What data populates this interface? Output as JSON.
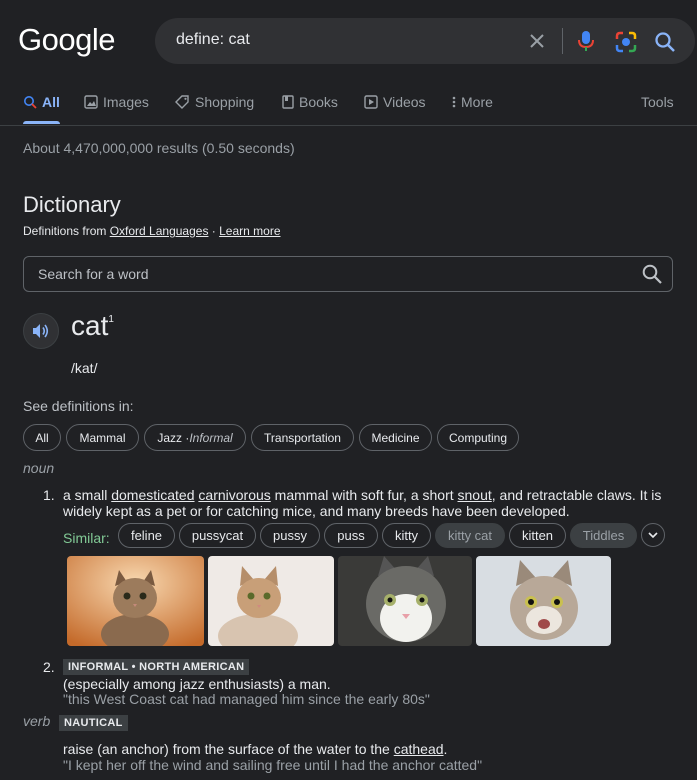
{
  "header": {
    "logo_text": "Google",
    "query": "define: cat",
    "icons": [
      "clear-icon",
      "microphone-icon",
      "lens-camera-icon",
      "search-icon"
    ]
  },
  "tabs": [
    {
      "label": "All",
      "icon": "search-icon",
      "active": true
    },
    {
      "label": "Images",
      "icon": "image-icon"
    },
    {
      "label": "Shopping",
      "icon": "tag-icon"
    },
    {
      "label": "Books",
      "icon": "book-icon"
    },
    {
      "label": "Videos",
      "icon": "play-icon"
    },
    {
      "label": "More",
      "icon": "more-vert-icon"
    }
  ],
  "tools_label": "Tools",
  "result_stats": "About 4,470,000,000 results (0.50 seconds)",
  "dictionary": {
    "title": "Dictionary",
    "source_prefix": "Definitions from ",
    "source_link": "Oxford Languages",
    "source_sep": " · ",
    "learn_more": "Learn more",
    "search_placeholder": "Search for a word",
    "word": "cat",
    "word_sup": "1",
    "pronunciation": "/kat/",
    "see_definitions_in": "See definitions in:",
    "domains": [
      "All",
      "Mammal",
      "Jazz · ",
      "Informal",
      "Transportation",
      "Medicine",
      "Computing"
    ],
    "noun_label": "noun",
    "verb_label": "verb",
    "def1_num": "1.",
    "def1_a": "a small ",
    "def1_l1": "domesticated",
    "def1_b": " ",
    "def1_l2": "carnivorous",
    "def1_c": " mammal with soft fur, a short ",
    "def1_l3": "snout",
    "def1_d": ", and retractable claws. It is",
    "def1_line2": "widely kept as a pet or for catching mice, and many breeds have been developed.",
    "similar_label": "Similar:",
    "synonyms": [
      "feline",
      "pussycat",
      "pussy",
      "puss",
      "kitty",
      "kitty cat",
      "kitten",
      "Tiddles"
    ],
    "def2_num": "2.",
    "def2_tag": "INFORMAL • NORTH AMERICAN",
    "def2_text": "(especially among jazz enthusiasts) a man.",
    "def2_example": "\"this West Coast cat had managed him since the early 80s\"",
    "verb_tag": "NAUTICAL",
    "verb_text_a": "raise (an anchor) from the surface of the water to the ",
    "verb_link": "cathead",
    "verb_text_b": ".",
    "verb_example": "\"I kept her off the wind and sailing free until I had the anchor catted\""
  },
  "colors": {
    "background": "#202124",
    "accent": "#8ab4f8",
    "similar": "#81c995"
  }
}
